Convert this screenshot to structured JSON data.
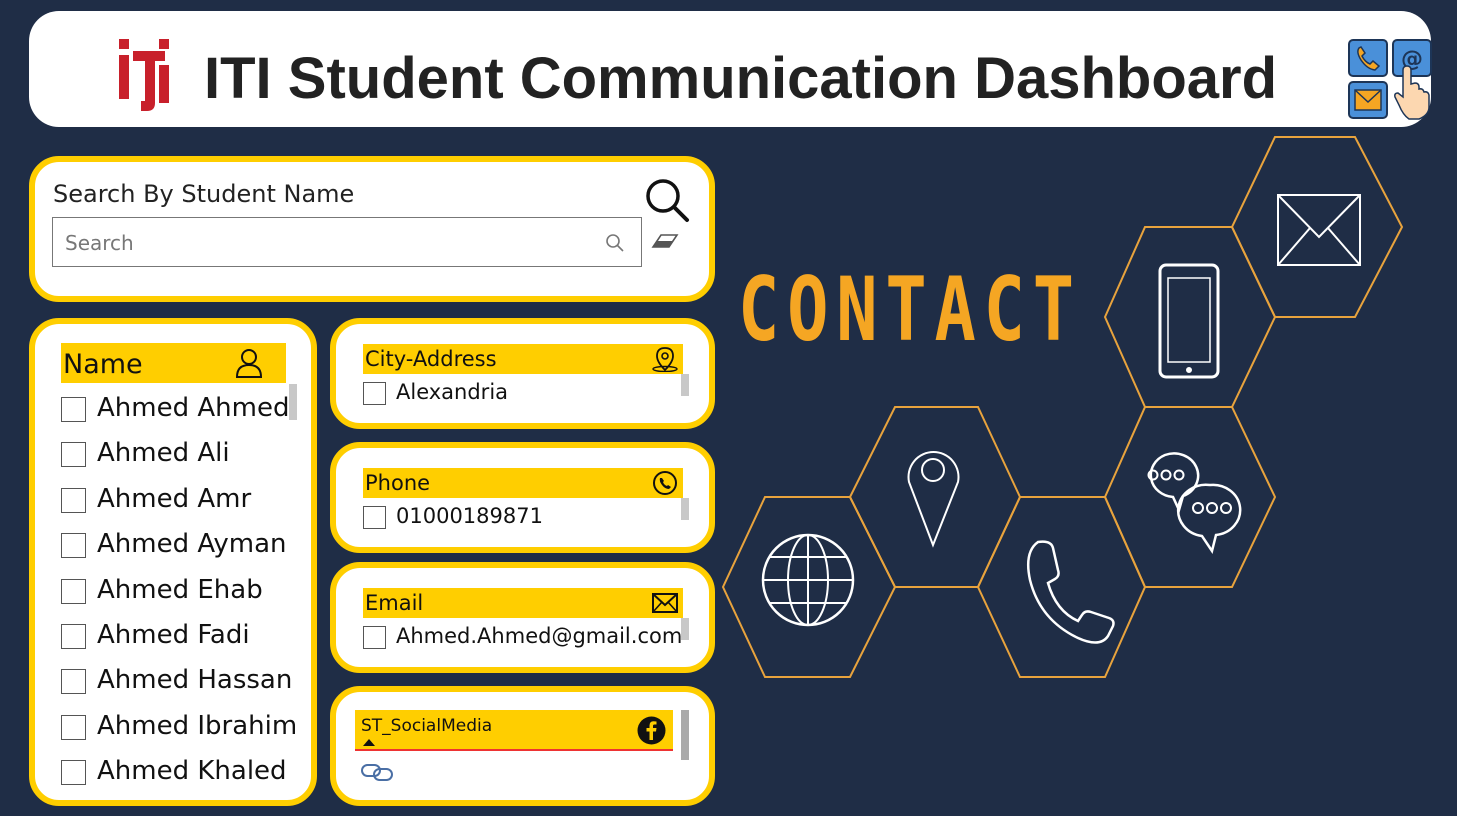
{
  "header": {
    "title": "ITI Student Communication Dashboard"
  },
  "search": {
    "title": "Search By Student Name",
    "placeholder": "Search"
  },
  "names": {
    "header": "Name",
    "items": [
      "Ahmed Ahmed",
      "Ahmed Ali",
      "Ahmed Amr",
      "Ahmed Ayman",
      "Ahmed Ehab",
      "Ahmed Fadi",
      "Ahmed Hassan",
      "Ahmed Ibrahim",
      "Ahmed Khaled"
    ]
  },
  "city": {
    "header": "City-Address",
    "value": "Alexandria"
  },
  "phone": {
    "header": "Phone",
    "value": "01000189871"
  },
  "email": {
    "header": "Email",
    "value": "Ahmed.Ahmed@gmail.com"
  },
  "social": {
    "header": "ST_SocialMedia"
  },
  "banner": {
    "word": "CONTACT"
  },
  "colors": {
    "accent": "#ffce00",
    "background": "#1f2d46",
    "orange": "#f5a623",
    "logo_red": "#c8202b"
  }
}
